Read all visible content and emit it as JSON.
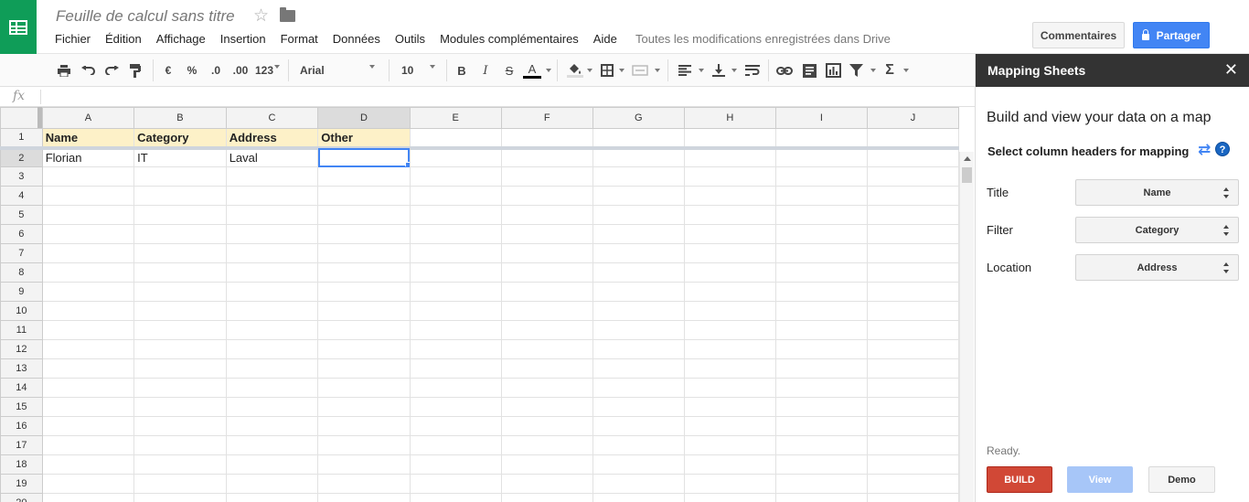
{
  "app": {
    "doc_title": "Feuille de calcul sans titre",
    "save_status": "Toutes les modifications enregistrées dans Drive"
  },
  "menu": [
    "Fichier",
    "Édition",
    "Affichage",
    "Insertion",
    "Format",
    "Données",
    "Outils",
    "Modules complémentaires",
    "Aide"
  ],
  "header_buttons": {
    "comments": "Commentaires",
    "share": "Partager"
  },
  "toolbar": {
    "currency": "€",
    "percent": "%",
    "decrease_decimals": ".0",
    "increase_decimals": ".00",
    "number_format": "123",
    "font": "Arial",
    "font_size": "10",
    "bold": "B",
    "italic": "I",
    "strike": "S",
    "text_color": "A",
    "sum": "Σ"
  },
  "formula": {
    "fx": "fx",
    "value": ""
  },
  "grid": {
    "columns": [
      "A",
      "B",
      "C",
      "D",
      "E",
      "F",
      "G",
      "H",
      "I",
      "J"
    ],
    "selected_column": "D",
    "selected_row": 2,
    "row_numbers": [
      1,
      2,
      3,
      4,
      5,
      6,
      7,
      8,
      9,
      10,
      11,
      12,
      13,
      14,
      15,
      16,
      17,
      18,
      19,
      20
    ],
    "rows": [
      [
        "Name",
        "Category",
        "Address",
        "Other",
        "",
        "",
        "",
        "",
        "",
        ""
      ],
      [
        "Florian",
        "IT",
        "Laval",
        "",
        "",
        "",
        "",
        "",
        "",
        ""
      ]
    ]
  },
  "sidebar": {
    "title": "Mapping Sheets",
    "close": "✕",
    "headline": "Build and view your data on a map",
    "subheadline": "Select column headers for mapping",
    "help": "?",
    "fields": [
      {
        "label": "Title",
        "value": "Name"
      },
      {
        "label": "Filter",
        "value": "Category"
      },
      {
        "label": "Location",
        "value": "Address"
      }
    ],
    "status": "Ready.",
    "buttons": {
      "build": "BUILD",
      "view": "View",
      "demo": "Demo"
    }
  },
  "colors": {
    "brand_green": "#0f9d58",
    "share_blue": "#4285f4",
    "build_red": "#d14836",
    "header_highlight": "#fdf1c8"
  }
}
